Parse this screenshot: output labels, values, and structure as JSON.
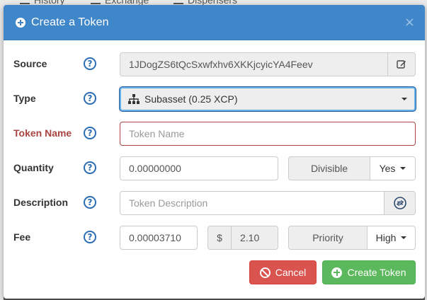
{
  "background_nav": {
    "items": [
      "History",
      "Exchange",
      "Dispensers"
    ]
  },
  "modal": {
    "title": "Create a Token",
    "close_glyph": "×",
    "header_color": "#3f87c9"
  },
  "fields": {
    "source": {
      "label": "Source",
      "value": "1JDogZS6tQcSxwfxhv6XKKjcyicYA4Feev",
      "edit_icon": "edit-icon"
    },
    "type": {
      "label": "Type",
      "value": "Subasset (0.25 XCP)",
      "icon": "sitemap-icon"
    },
    "token_name": {
      "label": "Token Name",
      "placeholder": "Token Name",
      "label_color": "#a94442"
    },
    "quantity": {
      "label": "Quantity",
      "value": "0.00000000",
      "divisible_label": "Divisible",
      "divisible_value": "Yes"
    },
    "description": {
      "label": "Description",
      "placeholder": "Token Description",
      "link_icon": "link-icon"
    },
    "fee": {
      "label": "Fee",
      "value": "0.00003710",
      "currency_symbol": "$",
      "usd_value": "2.10",
      "priority_label": "Priority",
      "priority_value": "High"
    }
  },
  "help_glyph": "?",
  "footer": {
    "cancel_label": "Cancel",
    "create_label": "Create Token"
  }
}
